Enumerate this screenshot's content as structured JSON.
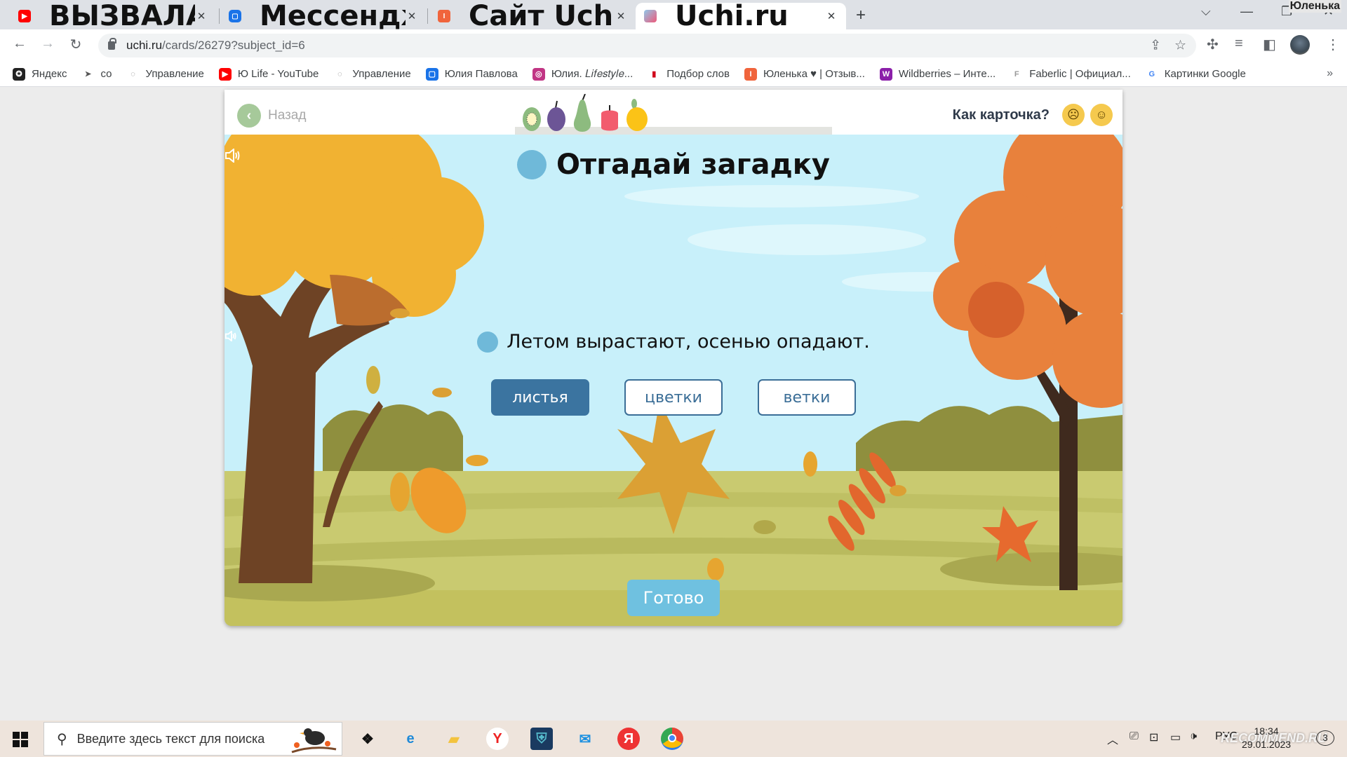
{
  "browser": {
    "tabs": [
      {
        "title": "ВЫЗВАЛА ПОЛИЦИЮ В ТРЕШ С",
        "icon": "youtube-icon",
        "color": "#ff0000"
      },
      {
        "title": "Мессенджер",
        "icon": "messenger-icon",
        "color": "#1a73e8"
      },
      {
        "title": "Сайт Uchi.ru - Учи.ру интеракти",
        "icon": "uchi-icon",
        "color": "#f0643c"
      },
      {
        "title": "Uchi.ru",
        "icon": "uchi-dino-icon",
        "color": "#ee5a7a",
        "active": true
      }
    ],
    "new_tab_label": "+",
    "profile_label": "Юленька",
    "url_host": "uchi.ru",
    "url_path": "/cards/26279?subject_id=6",
    "bookmarks": [
      {
        "label": "Яндекс",
        "icon": "yandex-icon",
        "color": "#222222"
      },
      {
        "label": "со",
        "icon": "telegram-icon",
        "color": "#555555"
      },
      {
        "label": "Управление",
        "icon": "chat-icon",
        "color": "#777777"
      },
      {
        "label": "Ю Life - YouTube",
        "icon": "youtube-icon",
        "color": "#ff0000"
      },
      {
        "label": "Управление",
        "icon": "chat-icon",
        "color": "#777777"
      },
      {
        "label": "Юлия Павлова",
        "icon": "messenger-icon",
        "color": "#1a73e8"
      },
      {
        "label": "Юлия. 𝐿𝑖𝑓𝑒𝑠𝑡𝑦𝑙𝑒...",
        "icon": "instagram-icon",
        "color": "#c13584"
      },
      {
        "label": "Подбор слов",
        "icon": "bars-icon",
        "color": "#d0021b"
      },
      {
        "label": "Юленька ♥ | Отзыв...",
        "icon": "otzovik-icon",
        "color": "#f0643c"
      },
      {
        "label": "Wildberries – Инте...",
        "icon": "wildberries-icon",
        "color": "#8b1fa9"
      },
      {
        "label": "Faberlic | Официал...",
        "icon": "faberlic-icon",
        "color": "#999999"
      },
      {
        "label": "Картинки Google",
        "icon": "google-icon",
        "color": "#4285f4"
      }
    ],
    "bookmarks_more": "»"
  },
  "card": {
    "back_label": "Назад",
    "rate_question": "Как карточка?",
    "rate_options": [
      {
        "name": "sad-face",
        "glyph": "☹"
      },
      {
        "name": "happy-face",
        "glyph": "☺"
      }
    ],
    "fruits": [
      "kiwi",
      "plum",
      "pear",
      "apple",
      "lemon"
    ],
    "title": "Отгадай загадку",
    "riddle": "Летом вырастают, осенью опадают.",
    "answers": [
      {
        "label": "листья",
        "selected": true
      },
      {
        "label": "цветки",
        "selected": false
      },
      {
        "label": "ветки",
        "selected": false
      }
    ],
    "done_label": "Готово",
    "colors": {
      "answer_selected": "#3b74a0",
      "answer_border": "#3b6e97",
      "done_button": "#6fc1e0",
      "speaker": "#6fb9d9",
      "sky": "#c8f0fa",
      "ground": "#c6c468"
    }
  },
  "taskbar": {
    "search_placeholder": "Введите здесь текст для поиска",
    "apps": [
      "dropbox",
      "edge",
      "file-explorer",
      "yandex-browser",
      "app-shield",
      "mail",
      "yandex",
      "chrome"
    ],
    "language": "РУС",
    "time": "18:34",
    "date": "29.01.2023",
    "notifications": "3",
    "watermark": "RECOMMEND.RU"
  }
}
